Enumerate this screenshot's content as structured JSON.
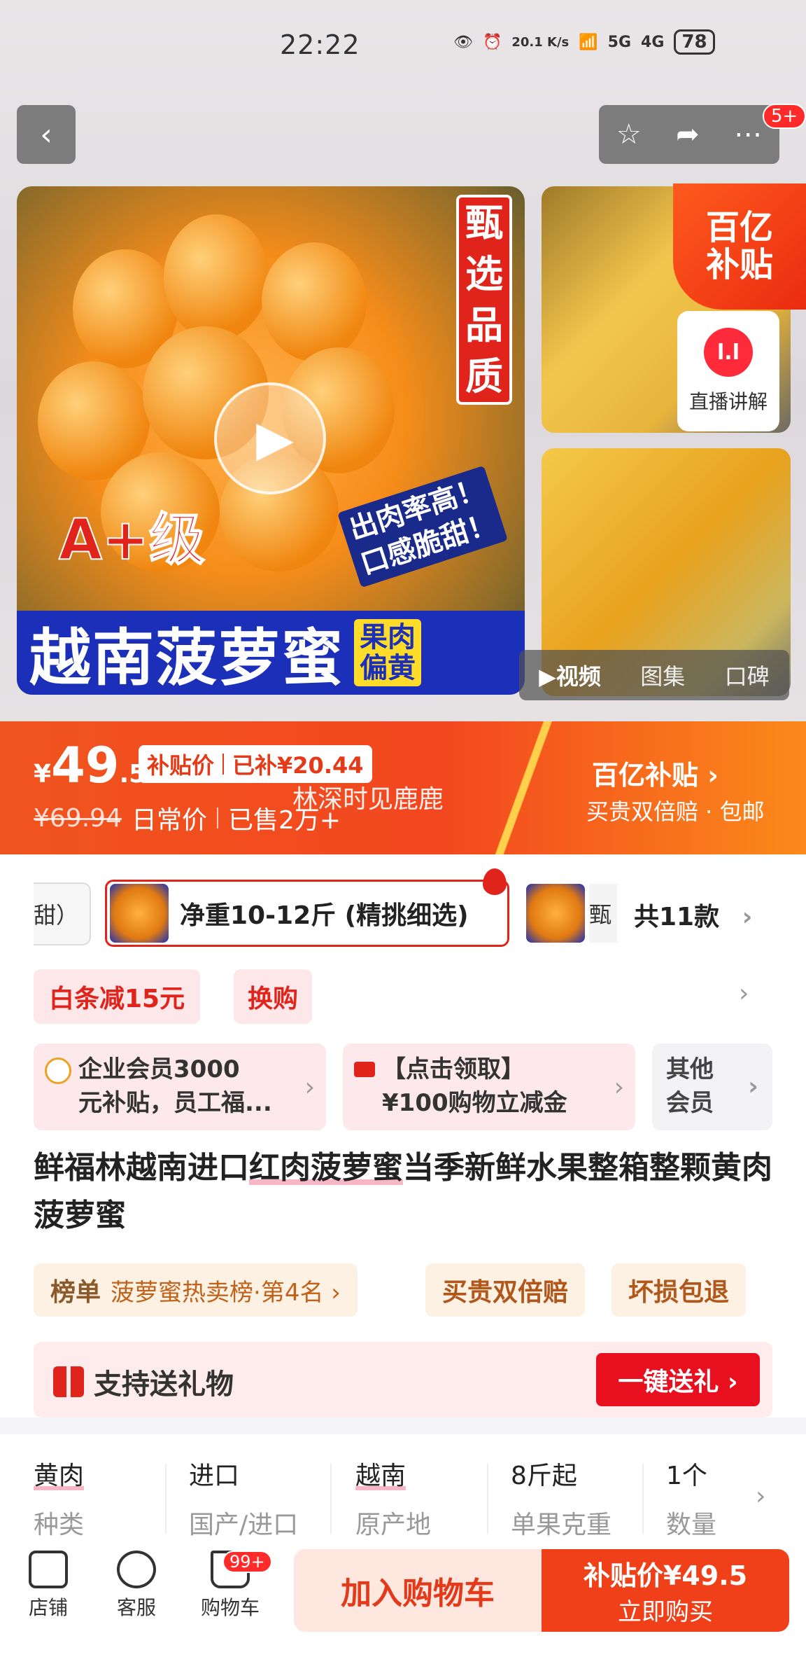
{
  "status_bar": {
    "time": "22:22",
    "speed": "20.1 K/s",
    "net1": "5G",
    "net2": "4G",
    "battery": "78"
  },
  "header": {
    "badge": "5+"
  },
  "gallery": {
    "tag_quality": [
      "甄",
      "选",
      "品",
      "质"
    ],
    "grade": "A+级",
    "slogan_line1": "出肉率高！",
    "slogan_line2": "口感脆甜！",
    "banner_main": "越南菠萝蜜",
    "banner_side1": "果肉",
    "banner_side2": "偏黄",
    "subsidy_tag_line1": "百亿",
    "subsidy_tag_line2": "补贴",
    "live_label": "直播讲解",
    "live_dot": "l.l",
    "tabs": [
      "▶视频",
      "图集",
      "口碑"
    ]
  },
  "price": {
    "currency": "¥",
    "integer": "49",
    "decimal": ".5",
    "subsidy_label": "补贴价",
    "subsidy_amount": "已补¥20.44",
    "original": "¥69.94",
    "original_label": "日常价",
    "sold": "已售2万+",
    "watermark": "林深时见鹿鹿",
    "right_title": "百亿补贴 ›",
    "right_sub": "买贵双倍赔 · 包邮"
  },
  "variants": {
    "left_partial": "甜）",
    "selected": "净重10-12斤 (精挑细选)",
    "next_partial": "甄",
    "count": "共11款"
  },
  "promos": {
    "p1": "白条减15元",
    "p2": "换购"
  },
  "coupons": {
    "c1_line1": "企业会员3000",
    "c1_line2": "元补贴，员工福...",
    "c2_line1": "【点击领取】",
    "c2_line2": "¥100购物立减金",
    "c3_line1": "其他",
    "c3_line2": "会员"
  },
  "product": {
    "title_pre": "鲜福林越南进口",
    "title_hl": "红肉菠萝蜜",
    "title_post": "当季新鲜水果整箱整颗黄肉菠萝蜜"
  },
  "rank": {
    "key": "榜单",
    "value": "菠萝蜜热卖榜·第4名 ›",
    "chip1": "买贵双倍赔",
    "chip2": "坏损包退"
  },
  "gift": {
    "label": "支持送礼物",
    "button": "一键送礼 ›"
  },
  "specs": [
    {
      "value": "黄肉",
      "key": "种类"
    },
    {
      "value": "进口",
      "key": "国产/进口"
    },
    {
      "value": "越南",
      "key": "原产地"
    },
    {
      "value": "8斤起",
      "key": "单果克重"
    },
    {
      "value": "1个",
      "key": "数量"
    }
  ],
  "bottom": {
    "store": "店铺",
    "service": "客服",
    "cart": "购物车",
    "cart_badge": "99+",
    "add_cart": "加入购物车",
    "buy_price": "补贴价¥49.5",
    "buy_now": "立即购买"
  },
  "icons": [
    "back-icon",
    "star-icon",
    "share-icon",
    "more-icon",
    "play-icon",
    "store-icon",
    "service-icon",
    "cart-icon",
    "gift-icon"
  ],
  "colors": {
    "accent": "#f0401a",
    "red": "#e0241b",
    "blue_banner": "#1b2fb8"
  }
}
